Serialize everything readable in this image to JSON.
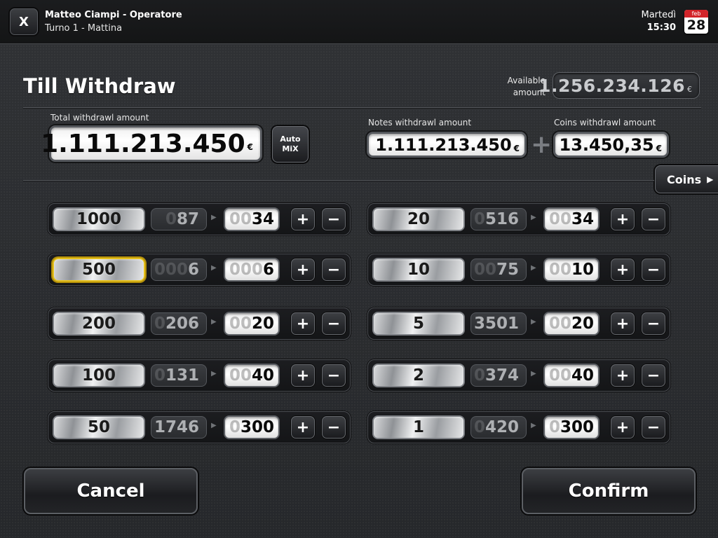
{
  "header": {
    "close_label": "X",
    "operator": "Matteo Ciampi - Operatore",
    "shift": "Turno 1 - Mattina",
    "day": "Martedì",
    "time": "15:30",
    "calendar": {
      "month": "feb",
      "day": "28"
    }
  },
  "title": "Till Withdraw",
  "available": {
    "label": "Available amount",
    "value": "1.256.234.126",
    "currency": "€"
  },
  "total": {
    "label": "Total withdrawl amount",
    "value": "1.111.213.450",
    "currency": "€"
  },
  "auto_mix": {
    "line1": "Auto",
    "line2": "MiX"
  },
  "notes": {
    "label": "Notes withdrawl amount",
    "value": "1.111.213.450",
    "currency": "€"
  },
  "coins": {
    "label": "Coins withdrawl amount",
    "value": "13.450,35",
    "currency": "€"
  },
  "coins_tab": {
    "label": "Coins",
    "arrow": "▶"
  },
  "controls": {
    "plus": "+",
    "minus": "−"
  },
  "notes_rows": [
    {
      "denom": "1000",
      "avail_pad": "0",
      "avail": "87",
      "wd_pad": "00",
      "wd": "34",
      "selected": false
    },
    {
      "denom": "500",
      "avail_pad": "000",
      "avail": "6",
      "wd_pad": "000",
      "wd": "6",
      "selected": true
    },
    {
      "denom": "200",
      "avail_pad": "0",
      "avail": "206",
      "wd_pad": "00",
      "wd": "20",
      "selected": false
    },
    {
      "denom": "100",
      "avail_pad": "0",
      "avail": "131",
      "wd_pad": "00",
      "wd": "40",
      "selected": false
    },
    {
      "denom": "50",
      "avail_pad": "",
      "avail": "1746",
      "wd_pad": "0",
      "wd": "300",
      "selected": false
    }
  ],
  "coins_rows": [
    {
      "denom": "20",
      "avail_pad": "0",
      "avail": "516",
      "wd_pad": "00",
      "wd": "34",
      "selected": false
    },
    {
      "denom": "10",
      "avail_pad": "00",
      "avail": "75",
      "wd_pad": "00",
      "wd": "10",
      "selected": false
    },
    {
      "denom": "5",
      "avail_pad": "",
      "avail": "3501",
      "wd_pad": "00",
      "wd": "20",
      "selected": false
    },
    {
      "denom": "2",
      "avail_pad": "0",
      "avail": "374",
      "wd_pad": "00",
      "wd": "40",
      "selected": false
    },
    {
      "denom": "1",
      "avail_pad": "0",
      "avail": "420",
      "wd_pad": "0",
      "wd": "300",
      "selected": false
    }
  ],
  "buttons": {
    "cancel": "Cancel",
    "confirm": "Confirm"
  }
}
